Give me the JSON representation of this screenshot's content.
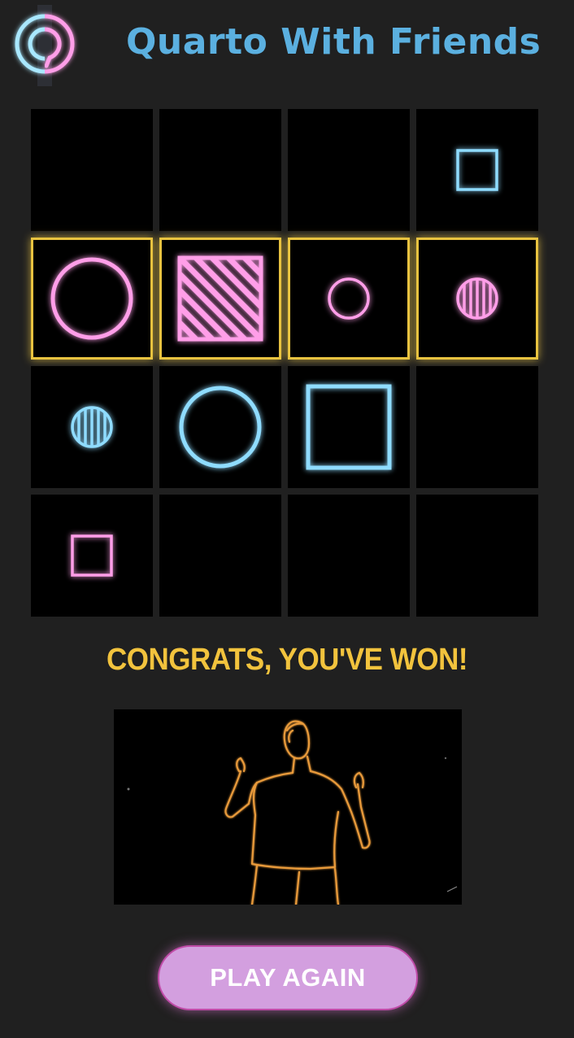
{
  "app": {
    "title": "Quarto With Friends",
    "logo_icon": "neon-chat-bubble-logo"
  },
  "colors": {
    "pink": "#ff9ee8",
    "blue": "#8fdcff",
    "win_border": "#e8c340",
    "title": "#5bb0e0",
    "message": "#f2c33d",
    "button_bg": "#d39fdf"
  },
  "board": {
    "rows": 4,
    "cols": 4,
    "winning_row": 2,
    "cells": [
      [
        null,
        null,
        null,
        {
          "color": "blue",
          "shape": "square",
          "size": "small",
          "fill": "hollow"
        }
      ],
      [
        {
          "color": "pink",
          "shape": "circle",
          "size": "large",
          "fill": "hollow"
        },
        {
          "color": "pink",
          "shape": "square",
          "size": "large",
          "fill": "striped"
        },
        {
          "color": "pink",
          "shape": "circle",
          "size": "small",
          "fill": "hollow"
        },
        {
          "color": "pink",
          "shape": "circle",
          "size": "small",
          "fill": "striped"
        }
      ],
      [
        {
          "color": "blue",
          "shape": "circle",
          "size": "small",
          "fill": "striped"
        },
        {
          "color": "blue",
          "shape": "circle",
          "size": "large",
          "fill": "hollow"
        },
        {
          "color": "blue",
          "shape": "square",
          "size": "large",
          "fill": "hollow"
        },
        null
      ],
      [
        {
          "color": "pink",
          "shape": "square",
          "size": "small",
          "fill": "hollow"
        },
        null,
        null,
        null
      ]
    ]
  },
  "result": {
    "message": "CONGRATS, YOU'VE WON!"
  },
  "celebration": {
    "image": "neon-line-drawing-dancing-person"
  },
  "actions": {
    "play_again_label": "PLAY AGAIN"
  }
}
